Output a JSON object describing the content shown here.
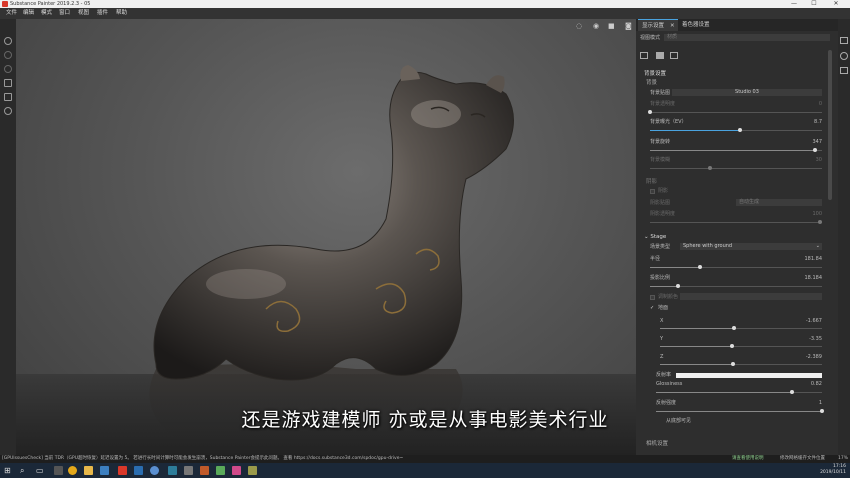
{
  "window": {
    "title": "Substance Painter 2019.2.3 - 05",
    "min": "—",
    "max": "☐",
    "close": "✕"
  },
  "menu": [
    "文件",
    "编辑",
    "模式",
    "窗口",
    "视图",
    "插件",
    "帮助"
  ],
  "panel": {
    "tabs": [
      "显示设置",
      "着色器设置"
    ],
    "tab_close": "✕",
    "view_mode_label": "视图模式",
    "view_mode_value": "材质",
    "section_bg": "背景设置",
    "bg_group": "背景",
    "rows": {
      "bg_map_label": "背景贴图",
      "bg_map_value": "Studio 03",
      "bg_opacity_label": "背景透明度",
      "bg_opacity_value": "0",
      "bg_exposure_label": "背景曝光（EV）",
      "bg_exposure_value": "8.7",
      "bg_rotation_label": "背景旋转",
      "bg_rotation_value": "347",
      "bg_blur_label": "背景模糊",
      "bg_blur_value": "30",
      "shadow_group": "阴影",
      "shadow_chk": "阴影",
      "shadow_map_label": "阴影贴图",
      "shadow_map_value": "自动生成",
      "shadow_opacity_label": "阴影透明度",
      "shadow_opacity_value": "100",
      "stage_group": "Stage",
      "stage_type_label": "场景类型",
      "stage_type_value": "Sphere with ground",
      "radius_label": "半径",
      "radius_value": "181.84",
      "ground_ratio_label": "投影比例",
      "ground_ratio_value": "18.184",
      "tint_chk": "调制颜色",
      "floor_chk": "地面",
      "x_label": "X",
      "x_value": "-1.667",
      "y_label": "Y",
      "y_value": "-3.35",
      "z_label": "Z",
      "z_value": "-2.389",
      "color_label": "反射率",
      "gloss_label": "Glossiness",
      "gloss_value": "0.82",
      "refl_label": "反射强度",
      "refl_value": "1",
      "visible_label": "从底部可见",
      "footer_section": "相机设置"
    }
  },
  "subtitle": "还是游戏建模师 亦或是从事电影美术行业",
  "status": {
    "left": "[GPUIssuesCheck] 当前 TDR（GPU超时恢复）延迟设置为 5。 若进行长时间计算时可能会发生崩溃，Substance Painter会提示此问题。 查看 https://docs.substance3d.com/spdoc/gpu-drive~",
    "mid": "请查看使用说明",
    "right": "修改网格缓存文件位置",
    "pct": "17%"
  },
  "clock": {
    "time": "17:16",
    "date": "2019/10/11"
  },
  "colors": {
    "accent": "#4aa3df",
    "panel": "#2e2e2e",
    "taskbar": "#1b2838"
  },
  "chart_data": null
}
